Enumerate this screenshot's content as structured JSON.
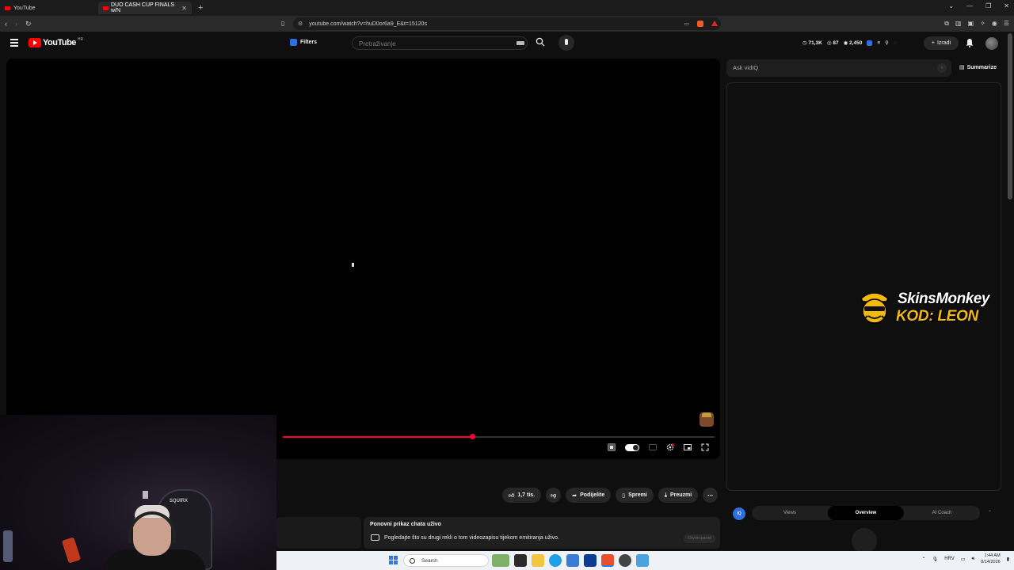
{
  "browser": {
    "tabs": [
      {
        "title": "YouTube",
        "active": false
      },
      {
        "title": "DUO CASH CUP FINALS w/N",
        "active": true
      }
    ],
    "url": "youtube.com/watch?v=huD0or6a9_E&t=15120s"
  },
  "header": {
    "logo_text": "YouTube",
    "logo_sup": "HR",
    "filters_label": "Filters",
    "search_placeholder": "Pretraživanje",
    "stats": {
      "views": "71,3K",
      "likes": "87",
      "subs": "2,450"
    },
    "create_label": "Izradi"
  },
  "player": {
    "progress_fraction": 0.44
  },
  "actions": {
    "like_count": "1,7 tis.",
    "share_label": "Podijelite",
    "save_label": "Spremi",
    "download_label": "Preuzmi"
  },
  "chat_replay": {
    "title": "Ponovni prikaz chata uživo",
    "description": "Pogledajte što su drugi rekli o tom videozapisu tijekom emitiranja uživo.",
    "open_label": "Otvori panel"
  },
  "side": {
    "ask_placeholder": "Ask vidIQ",
    "summarize_label": "Summarize",
    "tabs": [
      "Views",
      "Overview",
      "AI Coach"
    ],
    "active_tab": "Overview",
    "logo_text": "IQ"
  },
  "sponsor": {
    "brand": "SkinsMonkey",
    "code": "KOD: LEON"
  },
  "webcam": {
    "chair_brand": "SQUIRX"
  },
  "taskbar": {
    "search_placeholder": "Search",
    "lang": "HRV",
    "time": "1:44 AM",
    "date": "8/14/2026"
  },
  "colors": {
    "accent_red": "#ff0033",
    "vidiq_blue": "#2f6fe0",
    "sponsor_gold": "#f2b90f"
  }
}
